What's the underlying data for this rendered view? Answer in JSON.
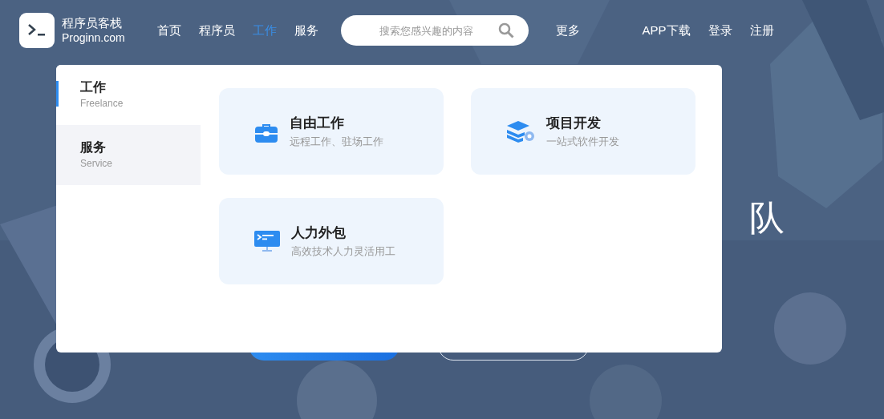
{
  "header": {
    "logo": {
      "name": "程序员客栈",
      "domain": "Proginn.com"
    },
    "nav": [
      {
        "label": "首页",
        "selected": false
      },
      {
        "label": "程序员",
        "selected": false
      },
      {
        "label": "工作",
        "selected": true
      },
      {
        "label": "服务",
        "selected": false
      }
    ],
    "search": {
      "placeholder": "搜索您感兴趣的内容"
    },
    "more": "更多",
    "links": [
      "APP下载",
      "登录",
      "注册"
    ]
  },
  "hero": {
    "heading": "队",
    "buttons": [
      {
        "kind": "primary"
      },
      {
        "kind": "outline"
      }
    ]
  },
  "dropdown": {
    "categories": [
      {
        "title": "工作",
        "subtitle": "Freelance",
        "selected": true
      },
      {
        "title": "服务",
        "subtitle": "Service",
        "selected": false
      }
    ],
    "cards": [
      {
        "kind": "briefcase",
        "title": "自由工作",
        "subtitle": "远程工作、驻场工作"
      },
      {
        "kind": "stack",
        "title": "项目开发",
        "subtitle": "一站式软件开发"
      },
      {
        "kind": "monitor",
        "title": "人力外包",
        "subtitle": "高效技术人力灵活用工"
      }
    ]
  }
}
